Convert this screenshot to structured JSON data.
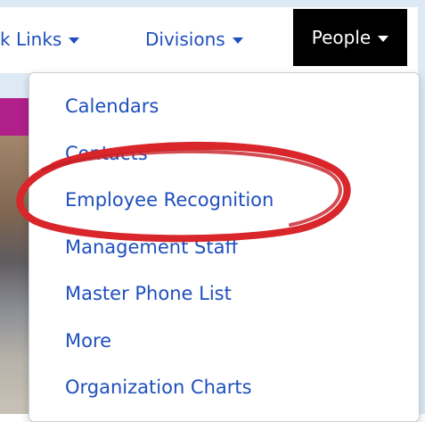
{
  "navbar": {
    "quick_links_label": "k Links",
    "divisions_label": "Divisions",
    "people_label": "People"
  },
  "dropdown": {
    "items": [
      {
        "label": "Calendars"
      },
      {
        "label": "Contacts"
      },
      {
        "label": "Employee Recognition"
      },
      {
        "label": "Management Staff"
      },
      {
        "label": "Master Phone List"
      },
      {
        "label": "More"
      },
      {
        "label": "Organization Charts"
      }
    ]
  },
  "colors": {
    "link": "#1e4fbd",
    "active_nav_bg": "#000000",
    "accent_bar": "#b01f8a",
    "annotation": "#d8262b"
  },
  "annotation": {
    "type": "red-hand-drawn-circle",
    "target": "Employee Recognition"
  }
}
